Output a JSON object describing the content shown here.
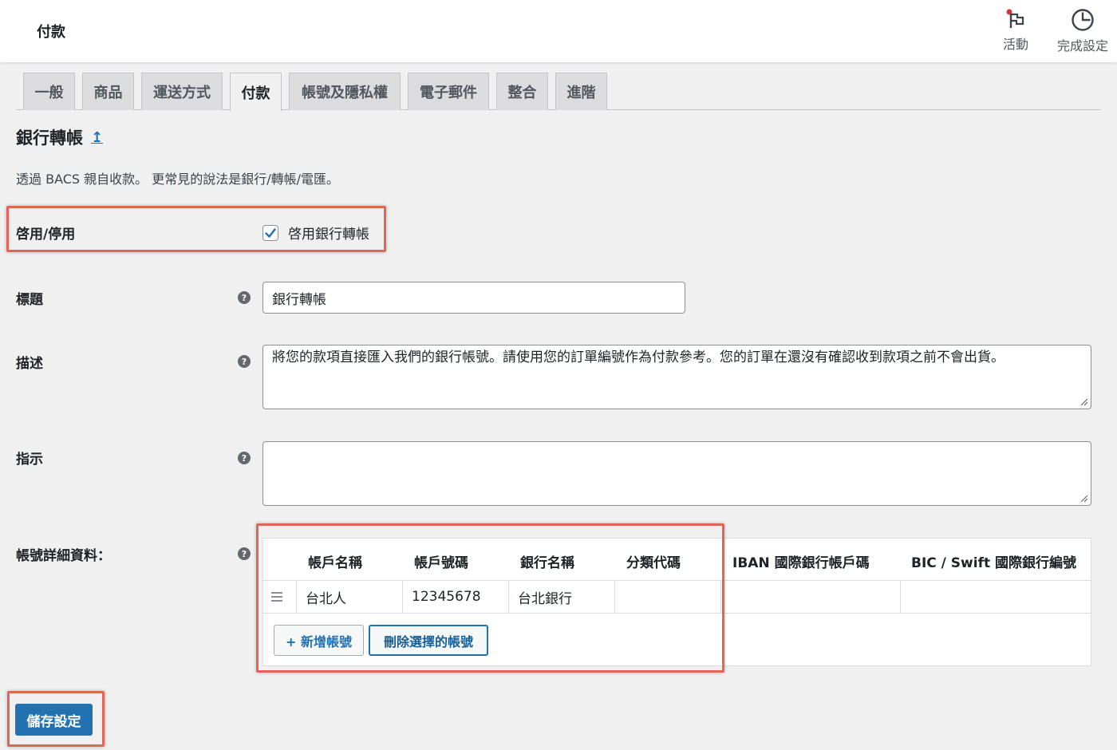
{
  "header": {
    "page_title": "付款",
    "activity_label": "活動",
    "finish_setup_label": "完成設定"
  },
  "tabs": [
    {
      "label": "一般"
    },
    {
      "label": "商品"
    },
    {
      "label": "運送方式"
    },
    {
      "label": "付款",
      "active": true
    },
    {
      "label": "帳號及隱私權"
    },
    {
      "label": "電子郵件"
    },
    {
      "label": "整合"
    },
    {
      "label": "進階"
    }
  ],
  "section": {
    "title": "銀行轉帳",
    "up_link": "↥",
    "description": "透過 BACS 親自收款。 更常見的說法是銀行/轉帳/電匯。"
  },
  "fields": {
    "enable": {
      "label": "啓用/停用",
      "checkbox_label": "啓用銀行轉帳",
      "checked": true
    },
    "title": {
      "label": "標題",
      "value": "銀行轉帳"
    },
    "description": {
      "label": "描述",
      "value": "將您的款項直接匯入我們的銀行帳號。請使用您的訂單編號作為付款參考。您的訂單在還沒有確認收到款項之前不會出貨。"
    },
    "instructions": {
      "label": "指示",
      "value": ""
    },
    "account_details": {
      "label": "帳號詳細資料："
    }
  },
  "help_glyph": "?",
  "accounts_table": {
    "columns": [
      "帳戶名稱",
      "帳戶號碼",
      "銀行名稱",
      "分類代碼",
      "IBAN 國際銀行帳戶碼",
      "BIC / Swift 國際銀行編號"
    ],
    "rows": [
      [
        "台北人",
        "12345678",
        "台北銀行",
        "",
        "",
        ""
      ]
    ],
    "add_button": "+ 新增帳號",
    "remove_button": "刪除選擇的帳號"
  },
  "save_button": "儲存設定",
  "colors": {
    "primary": "#2271b1",
    "highlight": "#e06656",
    "background": "#f0f0f1"
  }
}
